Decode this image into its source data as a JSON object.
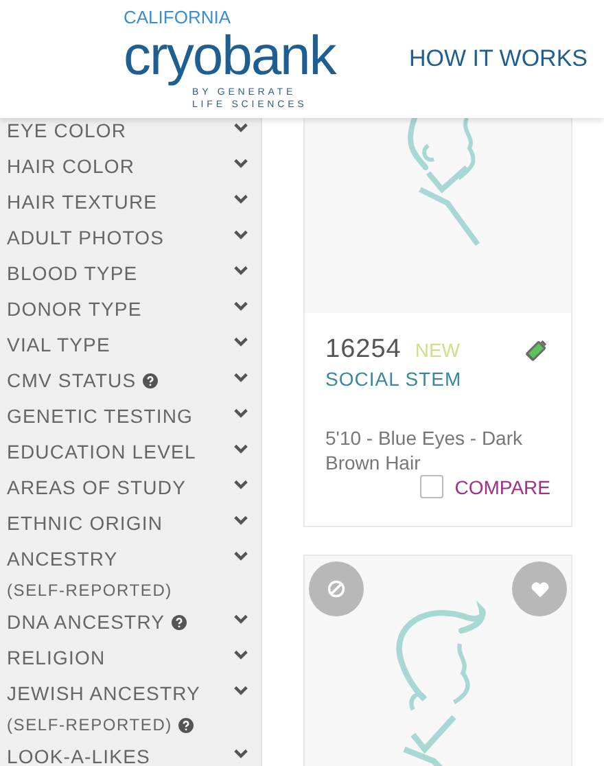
{
  "header": {
    "logo": {
      "top": "CALIFORNIA",
      "word": "cryobank",
      "tagline": [
        "BY GENERATE",
        "LIFE SCIENCES"
      ]
    },
    "nav_link": "HOW IT WORKS"
  },
  "filters": [
    {
      "label": "EYE COLOR",
      "help": false
    },
    {
      "label": "HAIR COLOR",
      "help": false
    },
    {
      "label": "HAIR TEXTURE",
      "help": false
    },
    {
      "label": "ADULT PHOTOS",
      "help": false
    },
    {
      "label": "BLOOD TYPE",
      "help": false
    },
    {
      "label": "DONOR TYPE",
      "help": false
    },
    {
      "label": "VIAL TYPE",
      "help": false
    },
    {
      "label": "CMV STATUS",
      "help": true
    },
    {
      "label": "GENETIC TESTING",
      "help": false
    },
    {
      "label": "EDUCATION LEVEL",
      "help": false
    },
    {
      "label": "AREAS OF STUDY",
      "help": false
    },
    {
      "label": "ETHNIC ORIGIN",
      "help": false
    },
    {
      "label": "ANCESTRY",
      "sublabel": "(SELF-REPORTED)",
      "help": false
    },
    {
      "label": "DNA ANCESTRY",
      "help": true
    },
    {
      "label": "RELIGION",
      "help": false
    },
    {
      "label": "JEWISH ANCESTRY",
      "sublabel": "(SELF-REPORTED)",
      "help": true
    },
    {
      "label": "LOOK-A-LIKES",
      "help": false
    }
  ],
  "donors": [
    {
      "id": "16254",
      "badge": "NEW",
      "type": "SOCIAL STEM",
      "description": "5'10 - Blue Eyes - Dark Brown Hair",
      "compare": {
        "label": "COMPARE",
        "checked": false
      }
    },
    {
      "kind": "picture"
    }
  ]
}
